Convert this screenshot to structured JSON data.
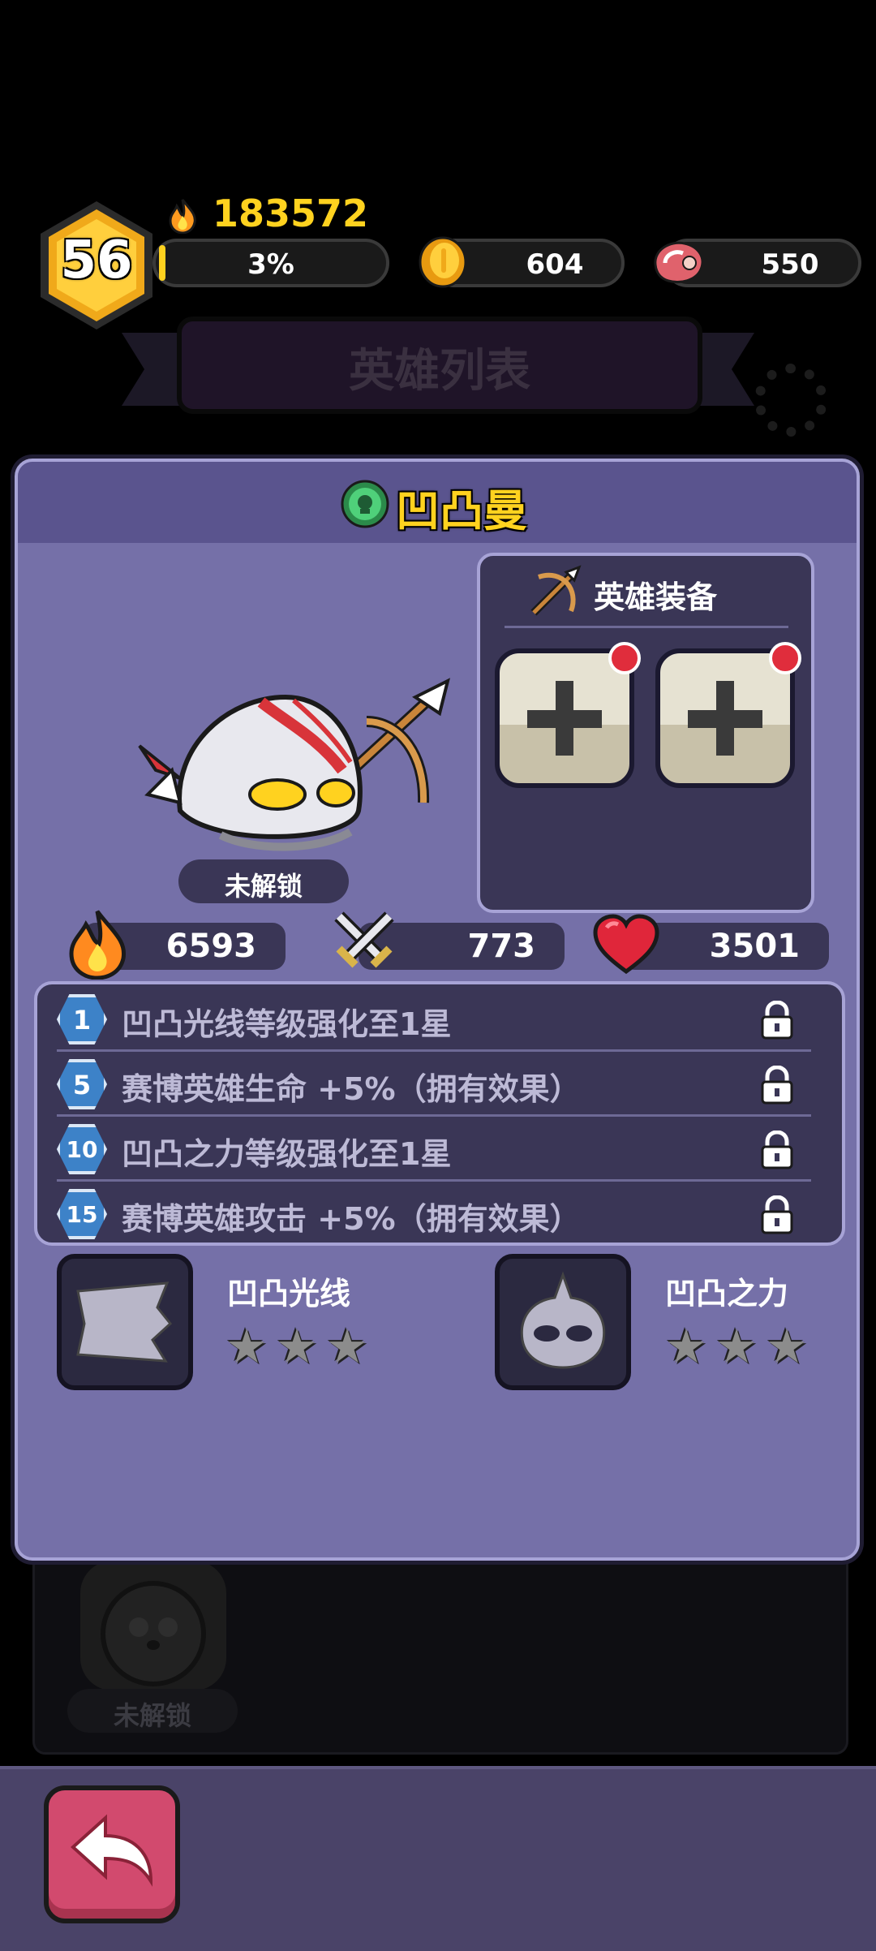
{
  "player": {
    "level": "56",
    "power": "183572",
    "exp_text": "3%",
    "exp_fraction": 0.03
  },
  "currency": {
    "coins": "604",
    "meat": "550"
  },
  "background": {
    "banner_title": "英雄列表",
    "behind_card_label": "未解锁"
  },
  "hero": {
    "name": "凹凸曼",
    "status": "未解锁",
    "stats": {
      "power": "6593",
      "attack": "773",
      "hp": "3501"
    }
  },
  "equipment": {
    "title": "英雄装备",
    "slots": [
      {
        "has_alert": true
      },
      {
        "has_alert": true
      }
    ]
  },
  "unlocks": [
    {
      "level": "1",
      "text": "凹凸光线等级强化至1星",
      "locked": true
    },
    {
      "level": "5",
      "text": "赛博英雄生命  +5%（拥有效果）",
      "locked": true
    },
    {
      "level": "10",
      "text": "凹凸之力等级强化至1星",
      "locked": true
    },
    {
      "level": "15",
      "text": "赛博英雄攻击  +5%（拥有效果）",
      "locked": true
    }
  ],
  "skills": [
    {
      "name": "凹凸光线",
      "stars": 0,
      "max_stars": 3
    },
    {
      "name": "凹凸之力",
      "stars": 0,
      "max_stars": 3
    }
  ],
  "colors": {
    "card_bg": "#7570a8",
    "card_header": "#5a548e",
    "gold": "#ffd21f",
    "back_button": "#d24a6e"
  }
}
